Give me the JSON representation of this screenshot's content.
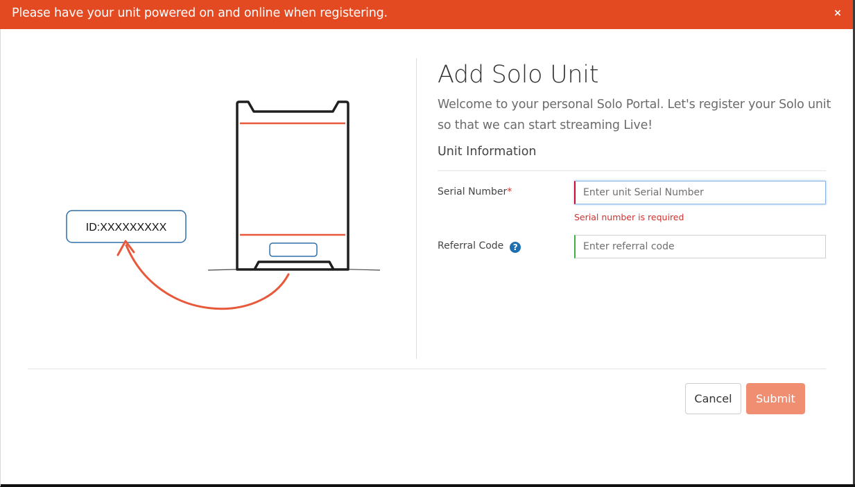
{
  "banner": {
    "message": "Please have your unit powered on and online when registering.",
    "close_glyph": "×",
    "color": "#e44a22"
  },
  "illustration": {
    "id_label": "ID:XXXXXXXXX",
    "accent_color": "#e8583a",
    "frame_color": "#1f1f1f",
    "slot_color": "#2f6ea8"
  },
  "form": {
    "title": "Add Solo Unit",
    "subtitle": "Welcome to your personal Solo Portal. Let's register your Solo unit so that we can start streaming Live!",
    "section_title": "Unit Information",
    "serial": {
      "label": "Serial Number",
      "required_mark": "*",
      "placeholder": "Enter unit Serial Number",
      "value": "",
      "error": "Serial number is required"
    },
    "referral": {
      "label": "Referral Code",
      "help_glyph": "?",
      "placeholder": "Enter referral code",
      "value": ""
    }
  },
  "footer": {
    "cancel_label": "Cancel",
    "submit_label": "Submit",
    "submit_color": "#f08e72"
  }
}
